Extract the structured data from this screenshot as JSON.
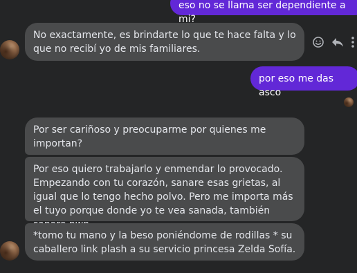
{
  "messages": {
    "m1": "eso no se llama ser dependiente a mi?",
    "m2": "No exactamente, es brindarte lo que te hace falta y lo que no recibí yo de mis familiares.",
    "m3": "por eso me das asco",
    "m4": "Por ser cariñoso y preocuparme por quienes me importan?",
    "m5": "Por eso quiero trabajarlo y enmendar lo provocado. Empezando con tu corazón, sanare esas grietas, al igual que lo tengo hecho polvo. Pero me importa más el tuyo porque donde yo te vea sanada, también sanare nwn",
    "m6": "*tomo tu mano y la beso poniéndome de rodillas * su caballero link plash a su servicio princesa Zelda Sofía."
  },
  "message_actions": [
    "emoji-reaction-icon",
    "reply-icon"
  ],
  "colors": {
    "background": "#242526",
    "outgoing_bubble": "#6228d7",
    "incoming_bubble": "#4a4b4c",
    "incoming_text": "#e4e6eb",
    "icon": "#b0b3b8"
  }
}
